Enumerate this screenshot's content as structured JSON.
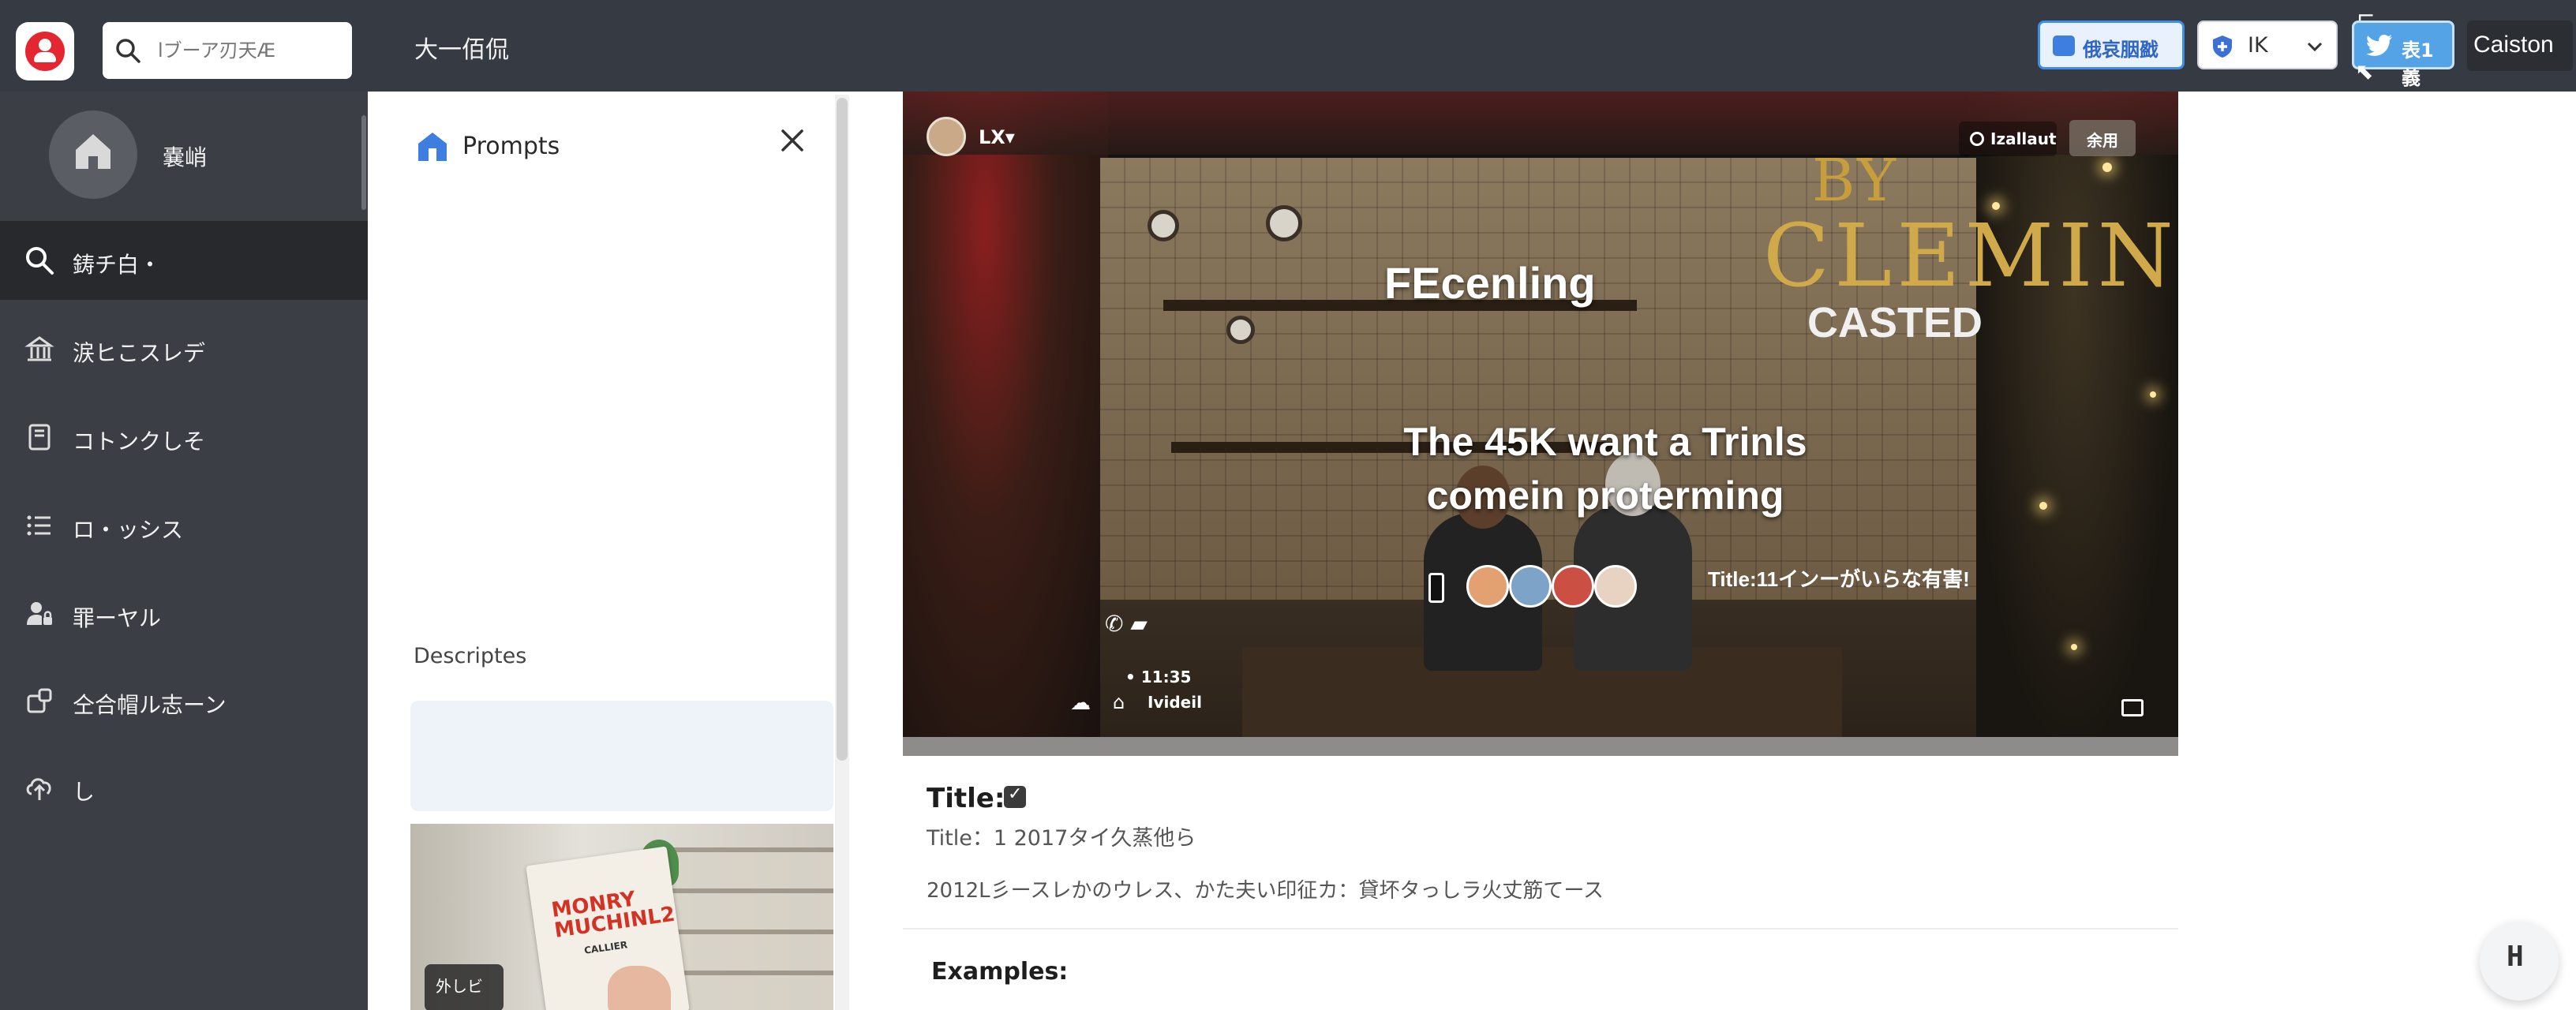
{
  "topbar": {
    "search_placeholder": "lブーア刃天Æ",
    "page_title": "大一佰侃",
    "btn_primary": "俄哀胭戤",
    "btn_select": "IK",
    "btn_twitter": "表1義",
    "btn_user": "Caiston",
    "colors": {
      "bar": "#363a42",
      "accent_blue": "#3d8ee8",
      "twitter": "#53a3e6",
      "logo_red": "#e32630"
    }
  },
  "sidebar": {
    "home_label": "嚢峭",
    "items": [
      {
        "label": "鋳チ白・",
        "icon": "search-icon",
        "active": true
      },
      {
        "label": "涙ヒこスレデ",
        "icon": "bank-icon"
      },
      {
        "label": "コトンクしそ",
        "icon": "book-icon"
      },
      {
        "label": "ロ・ッシス",
        "icon": "list-icon"
      },
      {
        "label": "罪ーヤル",
        "icon": "user-lock-icon"
      },
      {
        "label": "仝合帽ル志ーン",
        "icon": "share-icon"
      },
      {
        "label": "し",
        "icon": "upload-icon"
      }
    ]
  },
  "panel": {
    "title": "Prompts",
    "section": "Descriptes",
    "thumb_book_title": "MONRY MUCHINL2",
    "thumb_book_sub": "CALLIER",
    "thumb_badge": "外しビ"
  },
  "video": {
    "channel": "LX▾",
    "chip_live": "Izallaut",
    "chip_tag": "余用",
    "brand_by": "BY",
    "brand_name": "CLEMING",
    "brand_sub": "CASTED",
    "headline": "FEcenling",
    "main_text": "The 45K want a Trinls comein proterming",
    "side_title": "Title:11インーがいらな有害!",
    "time": "• 11:35",
    "source": "Ivideil"
  },
  "content": {
    "title_label": "Title:",
    "title_value": "Title：1 2017タイ久蒸他ら",
    "description": "2012L彡ースレかのウレス、かた夫い印征カ：貸坏タっしラ火丈筋てース",
    "examples_label": "Examples:",
    "fab_label": "H"
  }
}
